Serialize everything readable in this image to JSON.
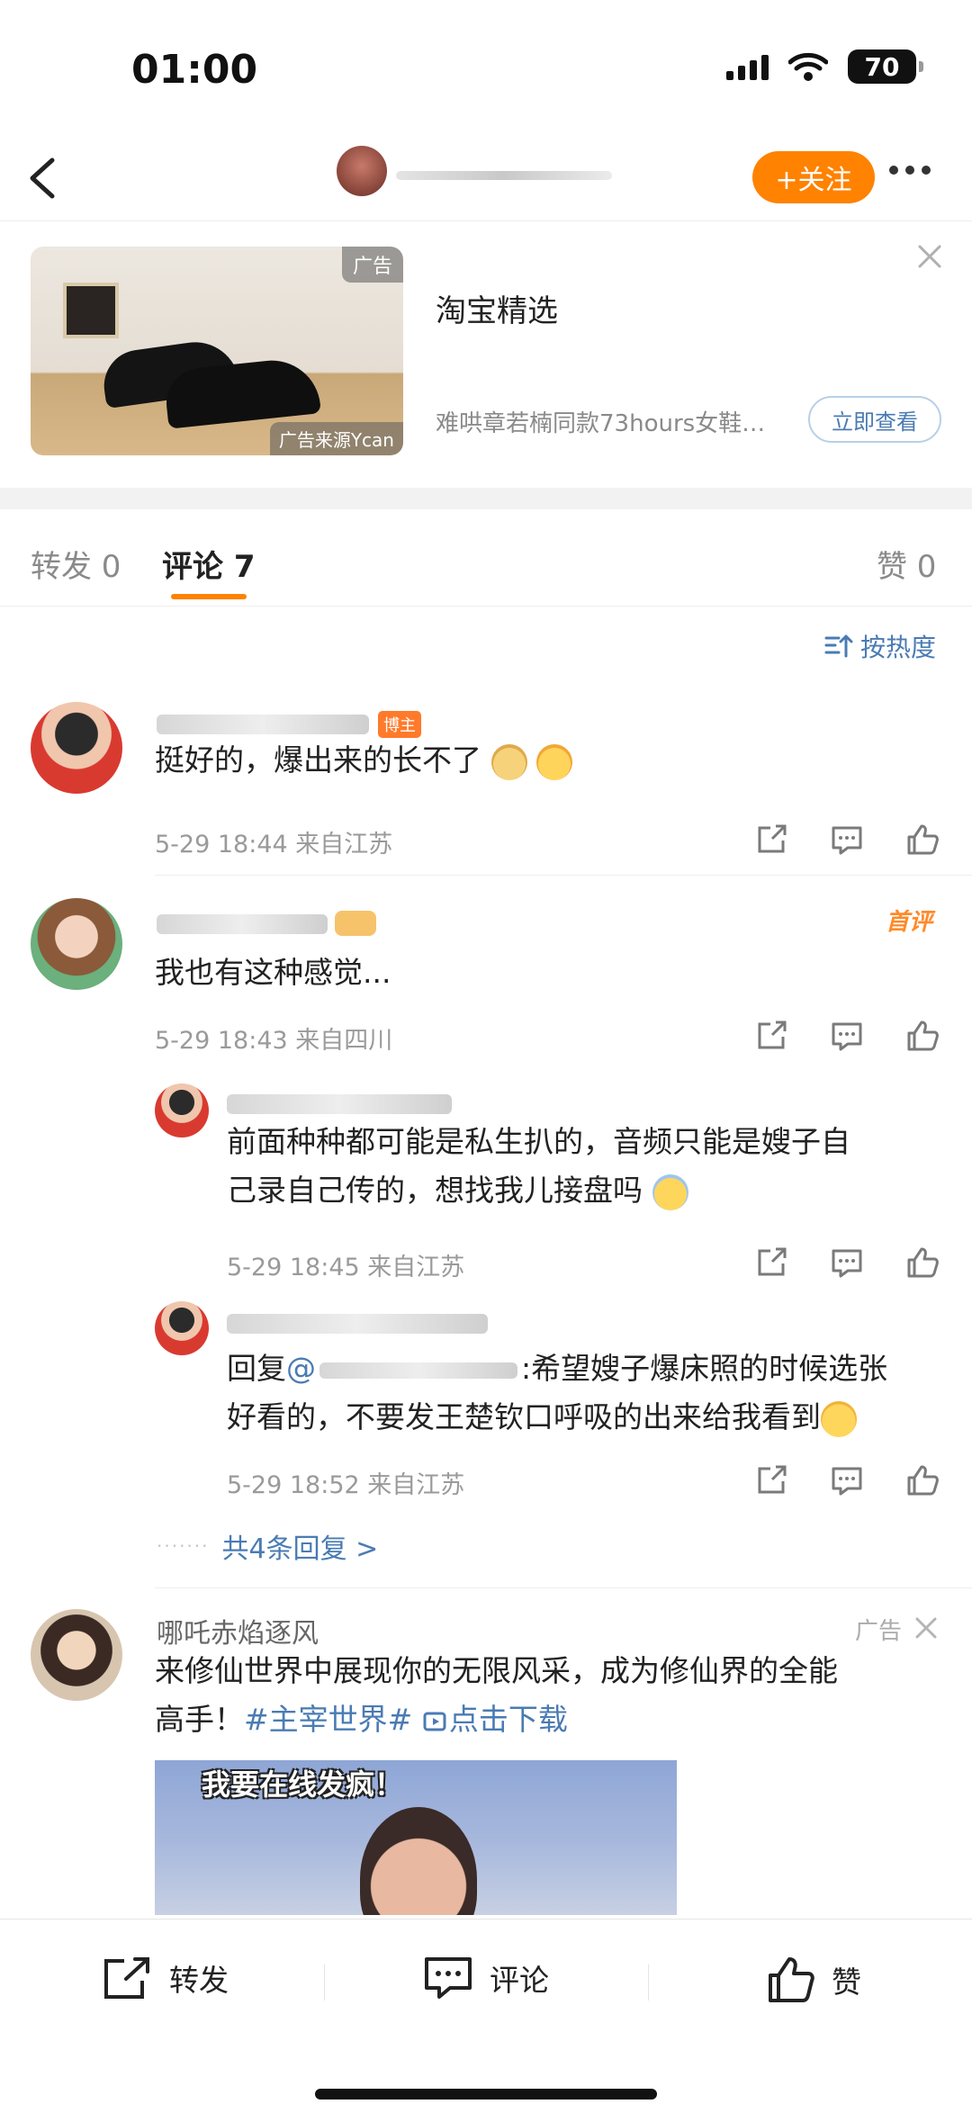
{
  "status_bar": {
    "time": "01:00",
    "battery": "70"
  },
  "nav": {
    "follow_label": "+关注"
  },
  "ad_banner": {
    "tag": "广告",
    "source": "广告来源Ycan",
    "title": "淘宝精选",
    "description": "难哄章若楠同款73hours女鞋…",
    "cta": "立即查看"
  },
  "tabs": {
    "repost": "转发 0",
    "comments": "评论 7",
    "likes": "赞 0"
  },
  "sort": {
    "label": "按热度"
  },
  "comments": [
    {
      "badge": "博主",
      "text": "挺好的，爆出来的长不了",
      "meta": "5-29 18:44  来自江苏"
    },
    {
      "badge": "首评",
      "text": "我也有这种感觉...",
      "meta": "5-29 18:43  来自四川",
      "replies": [
        {
          "text_line1": "前面种种都可能是私生扒的，音频只能是嫂子自",
          "text_line2": "己录自己传的，想找我儿接盘吗",
          "meta": "5-29 18:45  来自江苏"
        },
        {
          "prefix": "回复",
          "mention": "@",
          "text_line1": ":希望嫂子爆床照的时候选张",
          "text_line2": "好看的，不要发王楚钦口呼吸的出来给我看到",
          "meta": "5-29 18:52  来自江苏"
        }
      ],
      "more_replies": "共4条回复 >"
    }
  ],
  "ad_comment": {
    "name": "哪吒赤焰逐风",
    "label": "广告",
    "text_line1": "来修仙世界中展现你的无限风采，成为修仙界的全能",
    "text_line2_plain": "高手！",
    "hashtag": "#主宰世界#",
    "download": "点击下载",
    "video_caption": "我要在线发疯！"
  },
  "bottom_bar": {
    "repost": "转发",
    "comment": "评论",
    "like": "赞"
  },
  "colors": {
    "accent": "#ff8200",
    "link": "#4a7bb3"
  }
}
